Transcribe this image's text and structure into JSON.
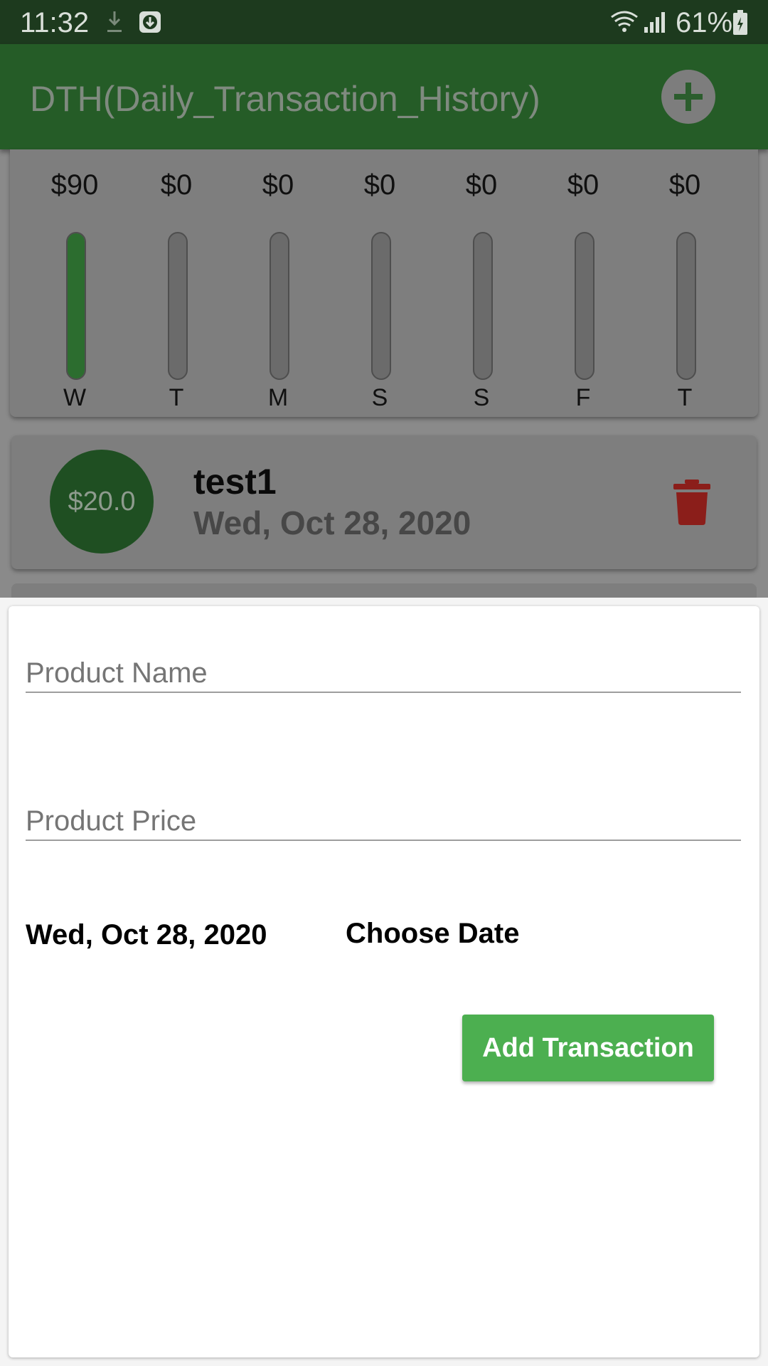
{
  "status_bar": {
    "time": "11:32",
    "battery": "61%",
    "icons": [
      "download-icon",
      "download-box-icon",
      "wifi-icon",
      "signal-icon",
      "battery-icon"
    ]
  },
  "app_bar": {
    "title": "DTH(Daily_Transaction_History)",
    "action_icon": "plus-icon"
  },
  "chart": {
    "bars": [
      {
        "amount": "$90",
        "day": "W",
        "fill": 1.0
      },
      {
        "amount": "$0",
        "day": "T",
        "fill": 0
      },
      {
        "amount": "$0",
        "day": "M",
        "fill": 0
      },
      {
        "amount": "$0",
        "day": "S",
        "fill": 0
      },
      {
        "amount": "$0",
        "day": "S",
        "fill": 0
      },
      {
        "amount": "$0",
        "day": "F",
        "fill": 0
      },
      {
        "amount": "$0",
        "day": "T",
        "fill": 0
      }
    ]
  },
  "transactions": [
    {
      "amount": "$20.0",
      "title": "test1",
      "date": "Wed, Oct 28, 2020",
      "action_icon": "trash-icon"
    }
  ],
  "form": {
    "product_name_label": "Product Name",
    "product_price_label": "Product Price",
    "selected_date": "Wed, Oct 28, 2020",
    "choose_date_label": "Choose Date",
    "submit_label": "Add Transaction"
  },
  "colors": {
    "app_bar": "#255c27",
    "accent_green": "#4caf50",
    "delete_red": "#8b1e1a"
  }
}
